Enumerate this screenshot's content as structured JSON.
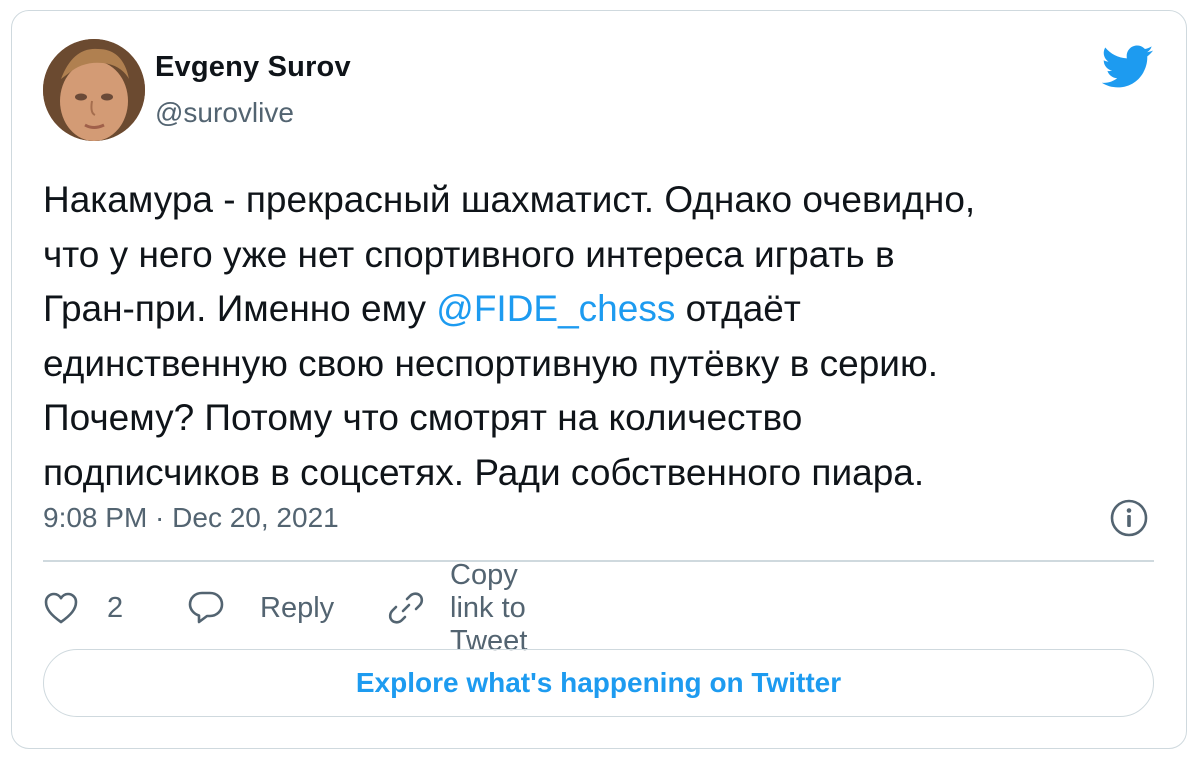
{
  "author": {
    "display_name": "Evgeny Surov",
    "handle": "@surovlive"
  },
  "tweet": {
    "lines": [
      {
        "text": "Накамура - прекрасный шахматист. Однако очевидно,"
      },
      {
        "text": "что у него уже нет спортивного интереса играть в"
      },
      {
        "before": "Гран-при. Именно ему ",
        "mention": "@FIDE_chess",
        "after": " отдаёт"
      },
      {
        "text": "единственную свою неспортивную путёвку в серию."
      },
      {
        "text": "Почему? Потому что смотрят на количество"
      },
      {
        "text": "подписчиков в соцсетях. Ради собственного пиара."
      }
    ],
    "timestamp": "9:08 PM · Dec 20, 2021"
  },
  "actions": {
    "like_count": "2",
    "reply_label": "Reply",
    "copy_link_label": "Copy link to Tweet"
  },
  "explore_button": "Explore what's happening on Twitter",
  "icons": {
    "brand": "twitter-bird-icon",
    "info": "info-icon",
    "like": "heart-icon",
    "reply": "speech-bubble-icon",
    "copy": "link-icon"
  },
  "colors": {
    "accent": "#1d9bf0",
    "text": "#0f1419",
    "secondary": "#536471",
    "border": "#cfd9de"
  }
}
